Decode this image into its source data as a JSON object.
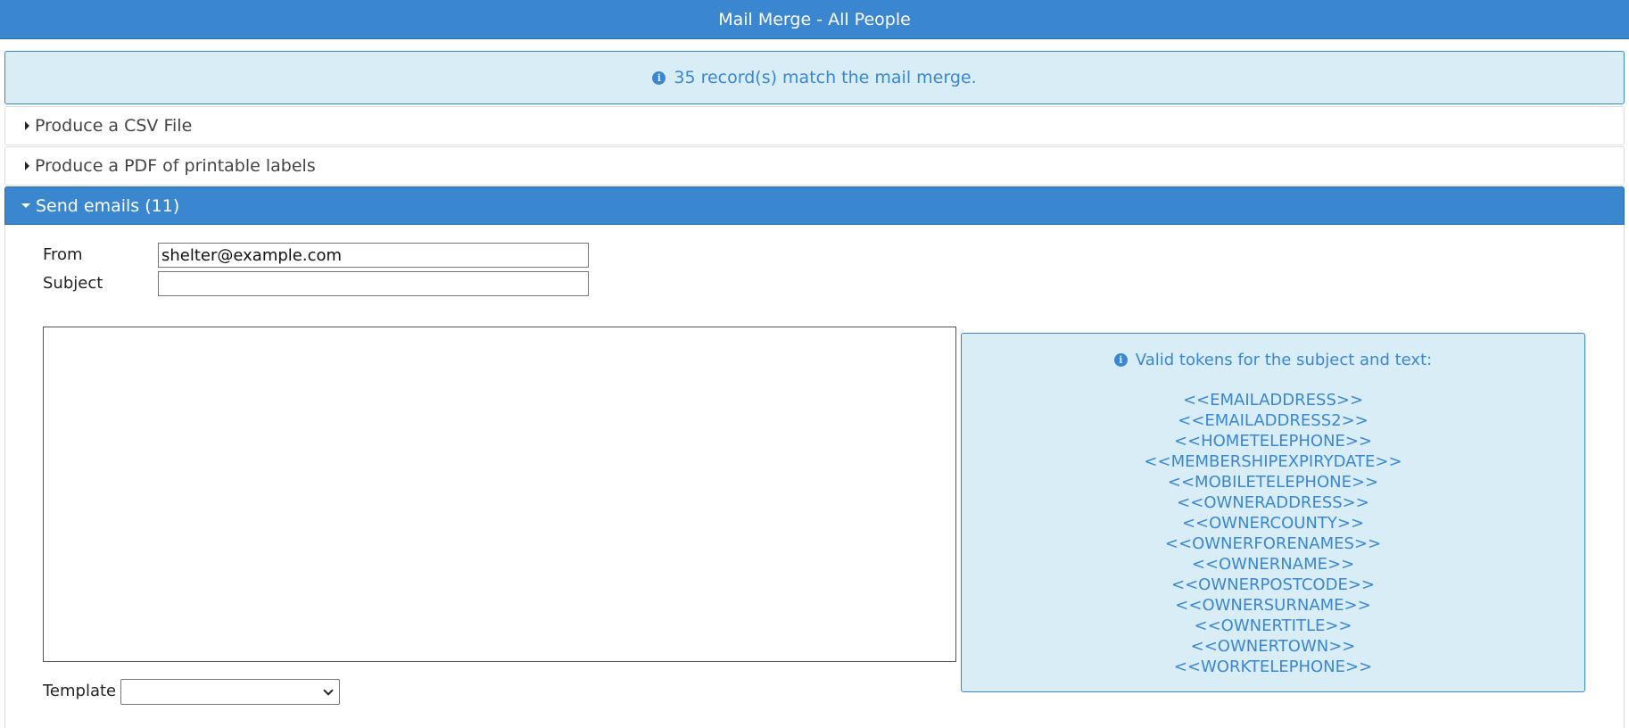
{
  "window": {
    "title": "Mail Merge - All People"
  },
  "banner": {
    "message": "35 record(s) match the mail merge."
  },
  "sections": {
    "csv_label": "Produce a CSV File",
    "pdf_label": "Produce a PDF of printable labels",
    "emails_label": "Send emails (11)"
  },
  "email_form": {
    "from_label": "From",
    "from_value": "shelter@example.com",
    "subject_label": "Subject",
    "subject_value": "",
    "body_value": "",
    "template_label": "Template",
    "template_selected": ""
  },
  "tokens": {
    "title": "Valid tokens for the subject and text:",
    "items": [
      "<<EMAILADDRESS>>",
      "<<EMAILADDRESS2>>",
      "<<HOMETELEPHONE>>",
      "<<MEMBERSHIPEXPIRYDATE>>",
      "<<MOBILETELEPHONE>>",
      "<<OWNERADDRESS>>",
      "<<OWNERCOUNTY>>",
      "<<OWNERFORENAMES>>",
      "<<OWNERNAME>>",
      "<<OWNERPOSTCODE>>",
      "<<OWNERSURNAME>>",
      "<<OWNERTITLE>>",
      "<<OWNERTOWN>>",
      "<<WORKTELEPHONE>>"
    ]
  },
  "colors": {
    "accent": "#3a87cf",
    "info_background": "#d9edf7"
  },
  "icons": {
    "info": "info-circle-icon",
    "collapsed": "caret-right-icon",
    "expanded": "caret-down-icon",
    "select": "chevron-down-icon"
  }
}
